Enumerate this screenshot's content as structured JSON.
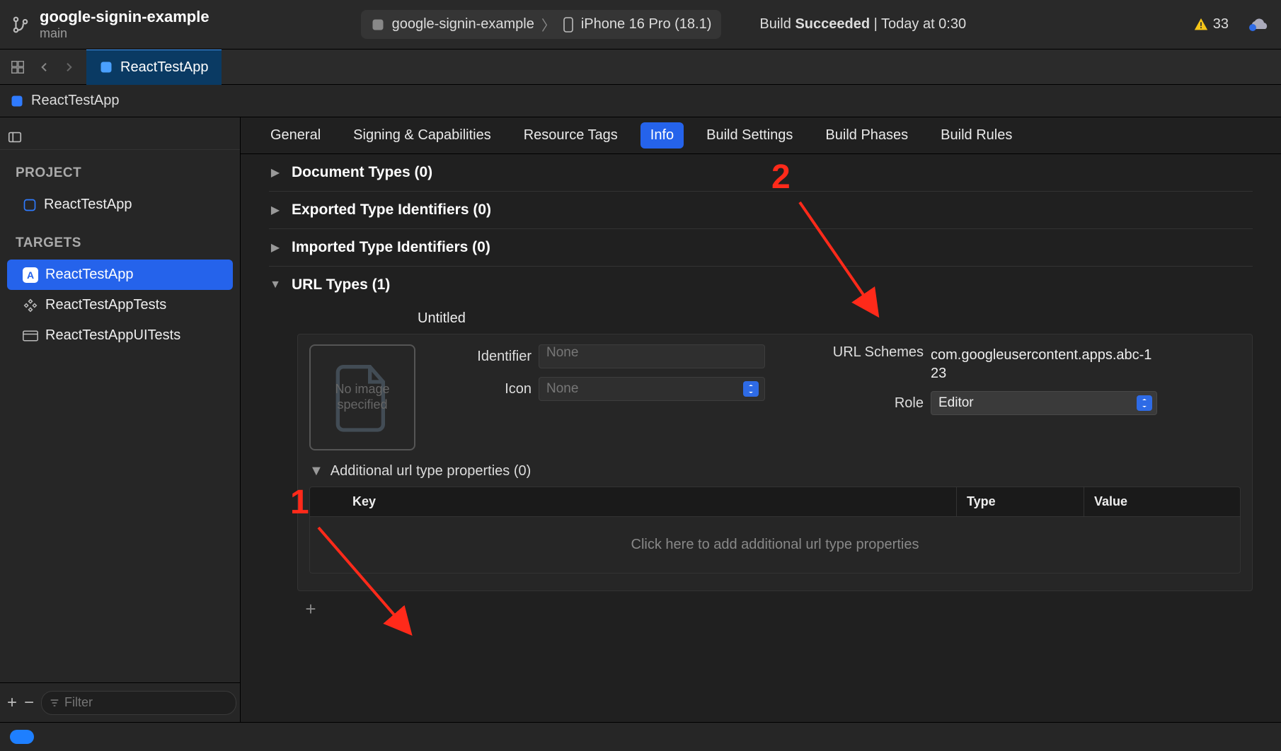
{
  "titlebar": {
    "project_name": "google-signin-example",
    "branch": "main",
    "scheme_name": "google-signin-example",
    "device": "iPhone 16 Pro (18.1)",
    "build_label": "Build",
    "build_status": "Succeeded",
    "build_sep": "|",
    "build_time": "Today at 0:30",
    "warning_count": "33"
  },
  "tab": {
    "label": "ReactTestApp"
  },
  "breadcrumb": {
    "label": "ReactTestApp"
  },
  "sidebar": {
    "project_heading": "PROJECT",
    "project_item": "ReactTestApp",
    "targets_heading": "TARGETS",
    "targets": [
      {
        "label": "ReactTestApp"
      },
      {
        "label": "ReactTestAppTests"
      },
      {
        "label": "ReactTestAppUITests"
      }
    ],
    "filter_placeholder": "Filter"
  },
  "editor_tabs": {
    "general": "General",
    "signing": "Signing & Capabilities",
    "resource": "Resource Tags",
    "info": "Info",
    "build_settings": "Build Settings",
    "build_phases": "Build Phases",
    "build_rules": "Build Rules"
  },
  "sections": {
    "doc_types": "Document Types (0)",
    "exported": "Exported Type Identifiers (0)",
    "imported": "Imported Type Identifiers (0)",
    "url_types": "URL Types (1)"
  },
  "url_type": {
    "title": "Untitled",
    "image_well_text": "No image specified",
    "identifier_label": "Identifier",
    "identifier_placeholder": "None",
    "icon_label": "Icon",
    "icon_placeholder": "None",
    "url_schemes_label": "URL Schemes",
    "url_schemes_value": "com.googleusercontent.apps.abc-123",
    "role_label": "Role",
    "role_value": "Editor",
    "additional_label": "Additional url type properties (0)",
    "table": {
      "key": "Key",
      "type": "Type",
      "value": "Value",
      "empty": "Click here to add additional url type properties"
    }
  },
  "annotations": {
    "one": "1",
    "two": "2"
  }
}
